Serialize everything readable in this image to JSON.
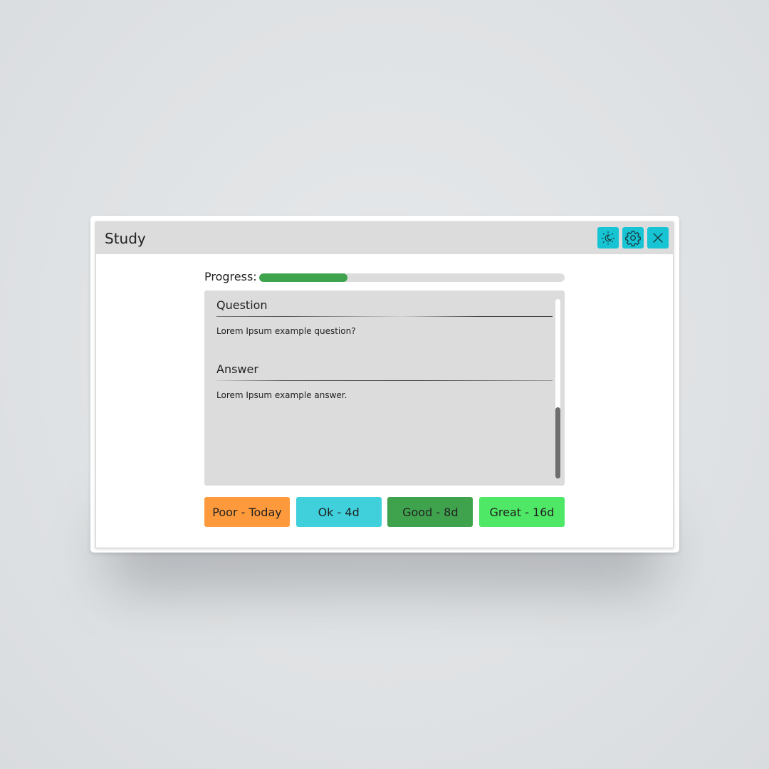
{
  "window": {
    "title": "Study",
    "buttons": [
      {
        "icon": "theme-toggle-icon"
      },
      {
        "icon": "gear-icon"
      },
      {
        "icon": "close-icon"
      }
    ],
    "accent_color": "#16c4d4"
  },
  "progress": {
    "label": "Progress:",
    "value": 0.29,
    "fill_color": "#3fa34d",
    "track_color": "#dcdcdc"
  },
  "card": {
    "question_heading": "Question",
    "question_text": "Lorem Ipsum example question?",
    "answer_heading": "Answer",
    "answer_text": "Lorem Ipsum example answer."
  },
  "ratings": [
    {
      "label": "Poor - Today",
      "color": "#ff9a3c"
    },
    {
      "label": "Ok - 4d",
      "color": "#3fd0dc"
    },
    {
      "label": "Good - 8d",
      "color": "#3fa34d"
    },
    {
      "label": "Great - 16d",
      "color": "#4ee766"
    }
  ]
}
